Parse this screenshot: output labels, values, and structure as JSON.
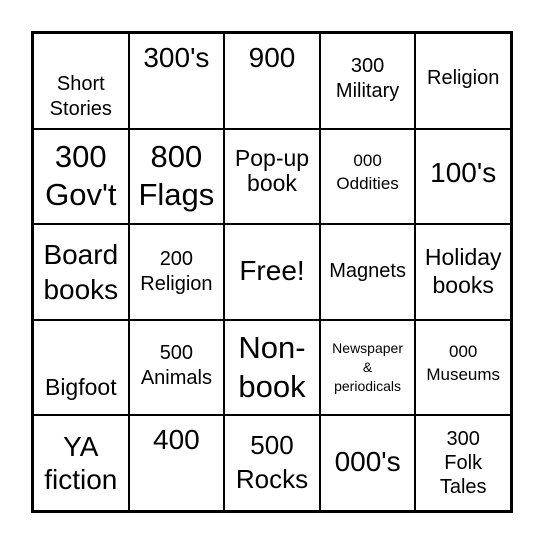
{
  "board": {
    "cells": [
      {
        "text": "Short\nStories"
      },
      {
        "text": "300's"
      },
      {
        "text": "900"
      },
      {
        "text": "300\nMilitary"
      },
      {
        "text": "Religion"
      },
      {
        "text": "300\nGov't"
      },
      {
        "text": "800\nFlags"
      },
      {
        "text": "Pop-up\nbook"
      },
      {
        "text": "000\nOddities"
      },
      {
        "text": "100's"
      },
      {
        "text": "Board\nbooks"
      },
      {
        "text": "200\nReligion"
      },
      {
        "text": "Free!"
      },
      {
        "text": "Magnets"
      },
      {
        "text": "Holiday\nbooks"
      },
      {
        "text": "Bigfoot"
      },
      {
        "text": "500\nAnimals"
      },
      {
        "text": "Non-\nbook"
      },
      {
        "text": "Newspaper\n&\nperiodicals"
      },
      {
        "text": "000\nMuseums"
      },
      {
        "text": "YA\nfiction"
      },
      {
        "text": "400"
      },
      {
        "text": "500\nRocks"
      },
      {
        "text": "000's"
      },
      {
        "text": "300\nFolk\nTales"
      }
    ]
  },
  "colors": {
    "grid_line": "#000000",
    "cell_background": "#ffffff",
    "text": "#000000"
  }
}
